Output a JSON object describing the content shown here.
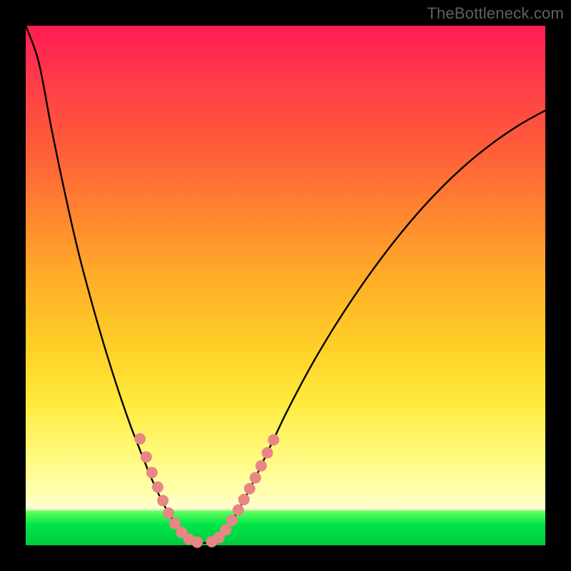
{
  "watermark": {
    "text": "TheBottleneck.com"
  },
  "colors": {
    "gradient_top": "#ff1b52",
    "gradient_mid": "#ffd028",
    "gradient_green": "#00e648",
    "curve": "#000000",
    "dots": "#e98585",
    "frame": "#000000"
  },
  "chart_data": {
    "type": "line",
    "title": "",
    "xlabel": "",
    "ylabel": "",
    "xlim": [
      0,
      100
    ],
    "ylim": [
      0,
      100
    ],
    "curve_points": [
      {
        "x": 0.0,
        "y": 100.0
      },
      {
        "x": 2.5,
        "y": 93.0
      },
      {
        "x": 5.0,
        "y": 80.0
      },
      {
        "x": 7.5,
        "y": 68.0
      },
      {
        "x": 10.0,
        "y": 57.0
      },
      {
        "x": 12.5,
        "y": 47.5
      },
      {
        "x": 15.0,
        "y": 38.8
      },
      {
        "x": 17.5,
        "y": 30.8
      },
      {
        "x": 20.0,
        "y": 23.5
      },
      {
        "x": 21.5,
        "y": 19.6
      },
      {
        "x": 23.0,
        "y": 15.8
      },
      {
        "x": 24.5,
        "y": 12.2
      },
      {
        "x": 26.0,
        "y": 9.0
      },
      {
        "x": 27.5,
        "y": 6.2
      },
      {
        "x": 29.0,
        "y": 4.0
      },
      {
        "x": 30.5,
        "y": 2.3
      },
      {
        "x": 32.0,
        "y": 1.1
      },
      {
        "x": 33.5,
        "y": 0.5
      },
      {
        "x": 35.5,
        "y": 0.6
      },
      {
        "x": 37.0,
        "y": 1.4
      },
      {
        "x": 38.5,
        "y": 3.0
      },
      {
        "x": 40.0,
        "y": 5.2
      },
      {
        "x": 41.5,
        "y": 7.8
      },
      {
        "x": 43.0,
        "y": 10.6
      },
      {
        "x": 44.5,
        "y": 13.6
      },
      {
        "x": 46.0,
        "y": 16.8
      },
      {
        "x": 48.0,
        "y": 21.0
      },
      {
        "x": 50.0,
        "y": 25.2
      },
      {
        "x": 53.0,
        "y": 31.0
      },
      {
        "x": 56.0,
        "y": 36.4
      },
      {
        "x": 60.0,
        "y": 43.0
      },
      {
        "x": 65.0,
        "y": 50.5
      },
      {
        "x": 70.0,
        "y": 57.3
      },
      {
        "x": 75.0,
        "y": 63.4
      },
      {
        "x": 80.0,
        "y": 68.8
      },
      {
        "x": 85.0,
        "y": 73.5
      },
      {
        "x": 90.0,
        "y": 77.5
      },
      {
        "x": 95.0,
        "y": 80.9
      },
      {
        "x": 100.0,
        "y": 83.7
      }
    ],
    "dots_left": [
      {
        "x": 22.0,
        "y": 20.5
      },
      {
        "x": 23.2,
        "y": 17.0
      },
      {
        "x": 24.3,
        "y": 14.0
      },
      {
        "x": 25.4,
        "y": 11.2
      },
      {
        "x": 26.4,
        "y": 8.6
      },
      {
        "x": 27.5,
        "y": 6.2
      },
      {
        "x": 28.7,
        "y": 4.2
      },
      {
        "x": 30.0,
        "y": 2.5
      },
      {
        "x": 31.4,
        "y": 1.2
      },
      {
        "x": 33.0,
        "y": 0.6
      }
    ],
    "dots_right": [
      {
        "x": 35.8,
        "y": 0.7
      },
      {
        "x": 37.2,
        "y": 1.5
      },
      {
        "x": 38.5,
        "y": 3.0
      },
      {
        "x": 39.7,
        "y": 4.8
      },
      {
        "x": 40.9,
        "y": 6.8
      },
      {
        "x": 42.0,
        "y": 8.8
      },
      {
        "x": 43.1,
        "y": 10.9
      },
      {
        "x": 44.2,
        "y": 13.0
      },
      {
        "x": 45.3,
        "y": 15.3
      },
      {
        "x": 46.5,
        "y": 17.8
      },
      {
        "x": 47.7,
        "y": 20.3
      }
    ]
  }
}
